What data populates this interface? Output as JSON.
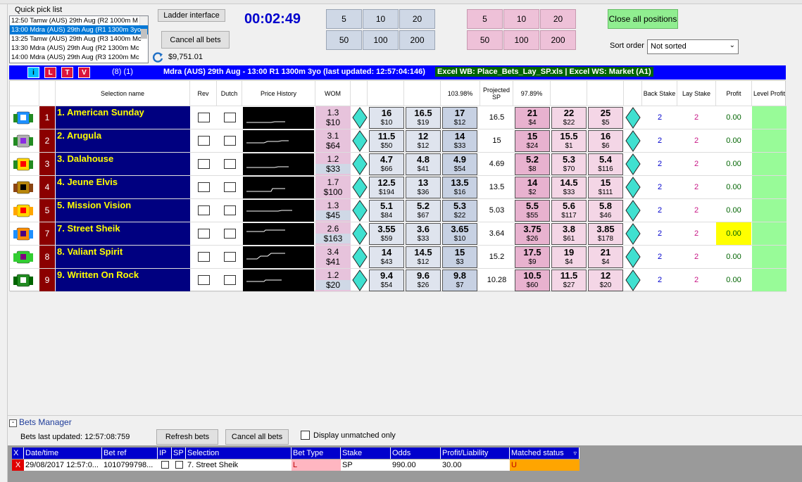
{
  "quick_pick": {
    "label": "Quick pick list",
    "items": [
      "12:50 Tamw (AUS) 29th Aug (R2 1000m M",
      "13:00 Mdra (AUS) 29th Aug (R1 1300m 3yo",
      "13:25 Tamw (AUS) 29th Aug (R3 1400m Mc",
      "13:30 Mdra (AUS) 29th Aug (R2 1300m Mc",
      "14:00 Mdra (AUS) 29th Aug (R3 1200m Mc"
    ]
  },
  "toolbar": {
    "ladder_interface": "Ladder interface",
    "cancel_all_bets": "Cancel all bets",
    "balance": "$9,751.01",
    "timer": "00:02:49",
    "back_stakes": [
      "5",
      "10",
      "20",
      "50",
      "100",
      "200"
    ],
    "lay_stakes": [
      "5",
      "10",
      "20",
      "50",
      "100",
      "200"
    ],
    "close_all_positions": "Close all positions",
    "sort_order_label": "Sort order",
    "sort_order_value": "Not sorted"
  },
  "market_bar": {
    "buttons": [
      "i",
      "L",
      "T",
      "V"
    ],
    "count": "(8) (1)",
    "title": "Mdra (AUS) 29th Aug - 13:00 R1 1300m 3yo (last updated: 12:57:04:146)",
    "excel": "Excel WB: Place_Bets_Lay_SP.xls | Excel WS: Market (A1)"
  },
  "grid_headers": {
    "selection_name": "Selection name",
    "rev": "Rev",
    "dutch": "Dutch",
    "price_history": "Price History",
    "wom": "WOM",
    "back_book": "103.98%",
    "projected_sp": "Projected SP",
    "lay_book": "97.89%",
    "back_stake": "Back Stake",
    "lay_stake": "Lay Stake",
    "profit": "Profit",
    "level_profit": "Level Profit"
  },
  "runners": [
    {
      "num": "1",
      "name": "1. American Sunday",
      "wom_top": "1.3",
      "wom_bot": "$10",
      "wom_back": false,
      "back": [
        [
          "16",
          "$10"
        ],
        [
          "16.5",
          "$19"
        ],
        [
          "17",
          "$12"
        ]
      ],
      "sp": "16.5",
      "lay": [
        [
          "21",
          "$4"
        ],
        [
          "22",
          "$22"
        ],
        [
          "25",
          "$5"
        ]
      ],
      "back_stake": "2",
      "lay_stake": "2",
      "profit": "0.00",
      "highlight": false
    },
    {
      "num": "2",
      "name": "2. Arugula",
      "wom_top": "3.1",
      "wom_bot": "$64",
      "wom_back": false,
      "back": [
        [
          "11.5",
          "$50"
        ],
        [
          "12",
          "$12"
        ],
        [
          "14",
          "$33"
        ]
      ],
      "sp": "15",
      "lay": [
        [
          "15",
          "$24"
        ],
        [
          "15.5",
          "$1"
        ],
        [
          "16",
          "$6"
        ]
      ],
      "back_stake": "2",
      "lay_stake": "2",
      "profit": "0.00",
      "highlight": false
    },
    {
      "num": "3",
      "name": "3. Dalahouse",
      "wom_top": "1.2",
      "wom_bot": "$33",
      "wom_back": true,
      "back": [
        [
          "4.7",
          "$66"
        ],
        [
          "4.8",
          "$41"
        ],
        [
          "4.9",
          "$54"
        ]
      ],
      "sp": "4.69",
      "lay": [
        [
          "5.2",
          "$8"
        ],
        [
          "5.3",
          "$70"
        ],
        [
          "5.4",
          "$116"
        ]
      ],
      "back_stake": "2",
      "lay_stake": "2",
      "profit": "0.00",
      "highlight": false
    },
    {
      "num": "4",
      "name": "4. Jeune Elvis",
      "wom_top": "1.7",
      "wom_bot": "$100",
      "wom_back": false,
      "back": [
        [
          "12.5",
          "$194"
        ],
        [
          "13",
          "$36"
        ],
        [
          "13.5",
          "$16"
        ]
      ],
      "sp": "13.5",
      "lay": [
        [
          "14",
          "$2"
        ],
        [
          "14.5",
          "$33"
        ],
        [
          "15",
          "$111"
        ]
      ],
      "back_stake": "2",
      "lay_stake": "2",
      "profit": "0.00",
      "highlight": false
    },
    {
      "num": "5",
      "name": "5. Mission Vision",
      "wom_top": "1.3",
      "wom_bot": "$45",
      "wom_back": true,
      "back": [
        [
          "5.1",
          "$84"
        ],
        [
          "5.2",
          "$67"
        ],
        [
          "5.3",
          "$22"
        ]
      ],
      "sp": "5.03",
      "lay": [
        [
          "5.5",
          "$55"
        ],
        [
          "5.6",
          "$117"
        ],
        [
          "5.8",
          "$46"
        ]
      ],
      "back_stake": "2",
      "lay_stake": "2",
      "profit": "0.00",
      "highlight": false
    },
    {
      "num": "7",
      "name": "7. Street Sheik",
      "wom_top": "2.6",
      "wom_bot": "$163",
      "wom_back": true,
      "back": [
        [
          "3.55",
          "$59"
        ],
        [
          "3.6",
          "$33"
        ],
        [
          "3.65",
          "$10"
        ]
      ],
      "sp": "3.64",
      "lay": [
        [
          "3.75",
          "$26"
        ],
        [
          "3.8",
          "$61"
        ],
        [
          "3.85",
          "$178"
        ]
      ],
      "back_stake": "2",
      "lay_stake": "2",
      "profit": "0.00",
      "highlight": true
    },
    {
      "num": "8",
      "name": "8. Valiant Spirit",
      "wom_top": "3.4",
      "wom_bot": "$41",
      "wom_back": false,
      "back": [
        [
          "14",
          "$43"
        ],
        [
          "14.5",
          "$12"
        ],
        [
          "15",
          "$3"
        ]
      ],
      "sp": "15.2",
      "lay": [
        [
          "17.5",
          "$9"
        ],
        [
          "19",
          "$4"
        ],
        [
          "21",
          "$4"
        ]
      ],
      "back_stake": "2",
      "lay_stake": "2",
      "profit": "0.00",
      "highlight": false
    },
    {
      "num": "9",
      "name": "9. Written On Rock",
      "wom_top": "1.2",
      "wom_bot": "$20",
      "wom_back": true,
      "back": [
        [
          "9.4",
          "$54"
        ],
        [
          "9.6",
          "$26"
        ],
        [
          "9.8",
          "$7"
        ]
      ],
      "sp": "10.28",
      "lay": [
        [
          "10.5",
          "$60"
        ],
        [
          "11.5",
          "$27"
        ],
        [
          "12",
          "$20"
        ]
      ],
      "back_stake": "2",
      "lay_stake": "2",
      "profit": "0.00",
      "highlight": false
    }
  ],
  "bets_manager": {
    "title": "Bets Manager",
    "collapse": "-",
    "last_updated": "Bets last updated: 12:57:08:759",
    "refresh": "Refresh bets",
    "cancel_all": "Cancel all bets",
    "display_unmatched": "Display unmatched only",
    "columns": [
      "X",
      "Date/time",
      "Bet ref",
      "IP",
      "SP",
      "Selection",
      "Bet Type",
      "Stake",
      "Odds",
      "Profit/Liability",
      "Matched status"
    ],
    "row": {
      "x": "X",
      "datetime": "29/08/2017  12:57:0...",
      "bet_ref": "1010799798...",
      "selection": "7. Street Sheik",
      "bet_type": "L",
      "stake": "SP",
      "odds": "990.00",
      "profit": "30.00",
      "status": "U"
    }
  },
  "colors": {
    "market_bar": "#0000ff",
    "name_bg": "#000080",
    "name_text": "#ffff00",
    "number_bg": "#8b0000",
    "level_profit": "#98fb98",
    "highlight": "#ffff00",
    "status_unmatched": "#ffa500"
  }
}
